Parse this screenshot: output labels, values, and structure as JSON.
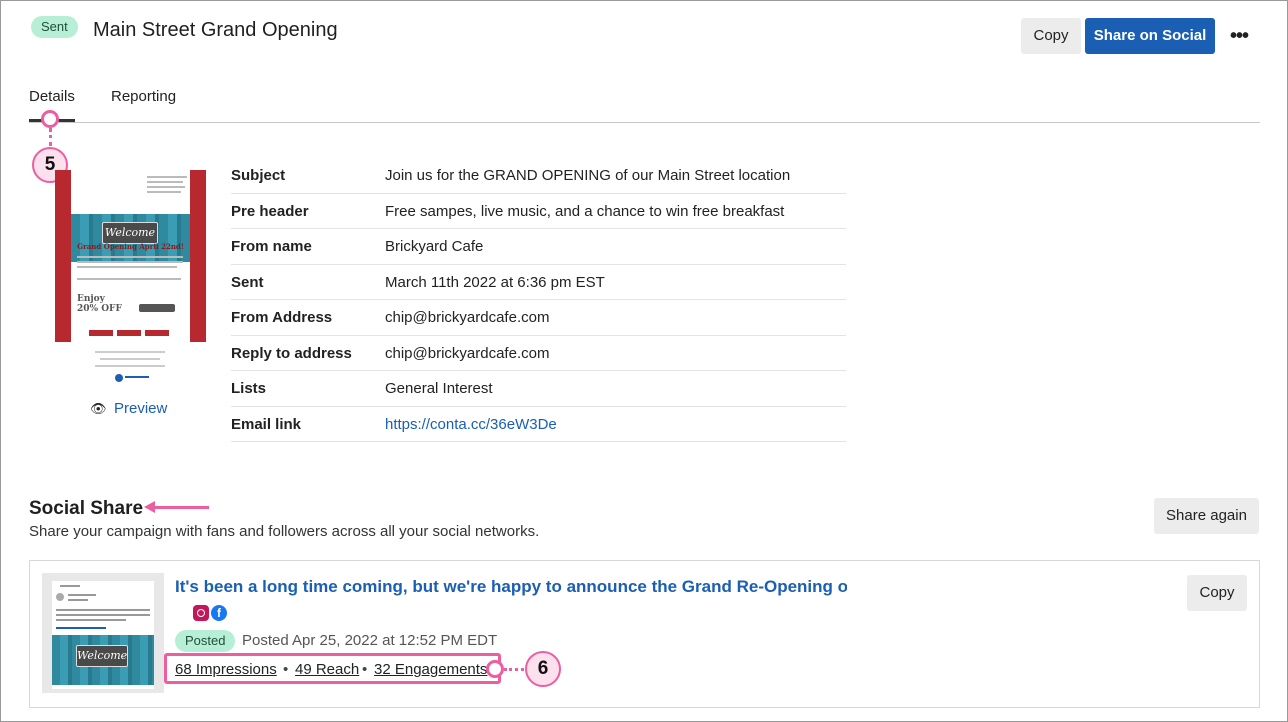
{
  "header": {
    "status_badge": "Sent",
    "title": "Main Street Grand Opening",
    "copy_label": "Copy",
    "share_social_label": "Share on Social",
    "more_label": "•••"
  },
  "tabs": [
    {
      "label": "Details",
      "active": true
    },
    {
      "label": "Reporting",
      "active": false
    }
  ],
  "callouts": {
    "first": "5",
    "second": "6"
  },
  "thumbnail": {
    "sign_text": "Welcome",
    "headline": "Grand Opening April 22nd!",
    "offer": "Enjoy 20% OFF"
  },
  "preview_label": "Preview",
  "details": [
    {
      "label": "Subject",
      "value": "Join us for the GRAND OPENING of our Main Street location"
    },
    {
      "label": "Pre header",
      "value": "Free sampes, live music, and a chance to win free breakfast"
    },
    {
      "label": "From name",
      "value": "Brickyard Cafe"
    },
    {
      "label": "Sent",
      "value": "March 11th 2022 at 6:36 pm EST"
    },
    {
      "label": "From Address",
      "value": "chip@brickyardcafe.com"
    },
    {
      "label": "Reply to address",
      "value": "chip@brickyardcafe.com"
    },
    {
      "label": "Lists",
      "value": "General Interest"
    },
    {
      "label": "Email link",
      "value": "https://conta.cc/36eW3De"
    }
  ],
  "social": {
    "title": "Social Share",
    "subtitle": "Share your campaign with fans and followers across all your social networks.",
    "share_again_label": "Share again",
    "post": {
      "title": "It's been a long time coming, but we're happy to announce the Grand Re-Opening o",
      "status": "Posted",
      "posted_at": "Posted Apr 25, 2022 at 12:52 PM EDT",
      "impressions": "68 Impressions",
      "reach": "49 Reach",
      "engagements": "32 Engagements",
      "separator": "•",
      "copy_label": "Copy",
      "fb_glyph": "f",
      "thumb_sign": "Welcome"
    }
  },
  "colors": {
    "accent": "#1a5fb4",
    "badge_green": "#b7efd6",
    "callout_pink": "#ec5ea0",
    "email_red": "#b8282f"
  }
}
